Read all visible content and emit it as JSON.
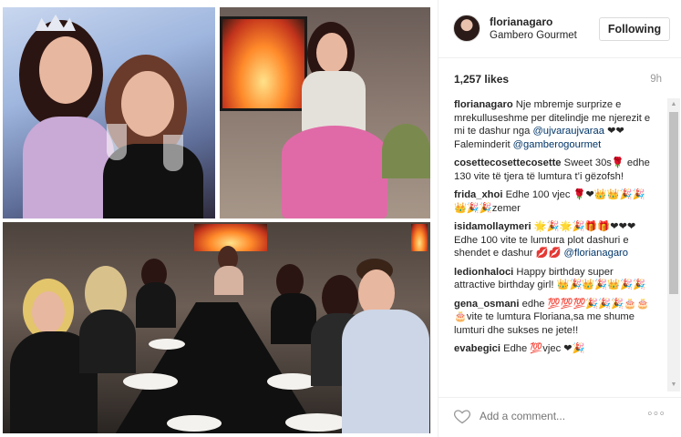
{
  "post": {
    "username": "florianagaro",
    "location": "Gambero Gourmet",
    "follow_label": "Following",
    "likes": "1,257 likes",
    "time": "9h",
    "add_comment_placeholder": "Add a comment...",
    "more_glyph": "◦◦◦"
  },
  "comments": [
    {
      "author": "florianagaro",
      "parts": [
        {
          "t": "text",
          "v": " Nje mbremje surprize e mrekulluseshme per ditelindje me njerezit e mi te dashur nga "
        },
        {
          "t": "mention",
          "v": "@ujvaraujvaraa"
        },
        {
          "t": "text",
          "v": " ❤❤ Faleminderit "
        },
        {
          "t": "mention",
          "v": "@gamberogourmet"
        }
      ]
    },
    {
      "author": "cosettecosettecosette",
      "parts": [
        {
          "t": "text",
          "v": " Sweet 30s🌹 edhe 130 vite të tjera të lumtura t’i gëzofsh!"
        }
      ]
    },
    {
      "author": "frida_xhoi",
      "parts": [
        {
          "t": "text",
          "v": " Edhe 100 vjec 🌹❤👑👑🎉🎉👑🎉🎉zemer"
        }
      ]
    },
    {
      "author": "isidamollaymeri",
      "parts": [
        {
          "t": "text",
          "v": " 🌟🎉🌟🎉🎁🎁❤❤❤ Edhe 100 vite te lumtura plot dashuri e shendet e dashur 💋💋 "
        },
        {
          "t": "mention",
          "v": "@florianagaro"
        }
      ]
    },
    {
      "author": "ledionhaloci",
      "parts": [
        {
          "t": "text",
          "v": " Happy birthday super attractive birthday girl! 👑🎉👑🎉👑🎉🎉"
        }
      ]
    },
    {
      "author": "gena_osmani",
      "parts": [
        {
          "t": "text",
          "v": " edhe 💯💯💯🎉🎉🎉🎂🎂🎂vite te lumtura Floriana,sa me shume lumturi dhe sukses ne jete!!"
        }
      ]
    },
    {
      "author": "evabegici",
      "parts": [
        {
          "t": "text",
          "v": " Edhe 💯vjec ❤🎉"
        }
      ]
    }
  ],
  "scrollbar": {
    "up": "▲",
    "down": "▼"
  },
  "photos": [
    {
      "name": "photo-celebrant-toast"
    },
    {
      "name": "photo-fireplace-dress"
    },
    {
      "name": "photo-dinner-table"
    }
  ]
}
